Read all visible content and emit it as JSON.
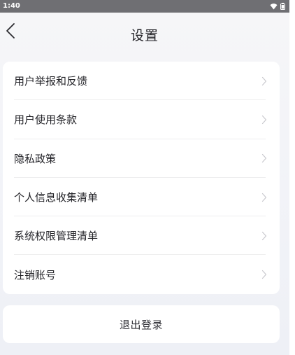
{
  "status_bar": {
    "time": "1:40",
    "icons": [
      "wifi-icon",
      "battery-icon"
    ]
  },
  "header": {
    "back_icon": "chevron-left-icon",
    "title": "设置"
  },
  "menu": {
    "items": [
      {
        "label": "用户举报和反馈",
        "icon": "chevron-right-icon"
      },
      {
        "label": "用户使用条款",
        "icon": "chevron-right-icon"
      },
      {
        "label": "隐私政策",
        "icon": "chevron-right-icon"
      },
      {
        "label": "个人信息收集清单",
        "icon": "chevron-right-icon"
      },
      {
        "label": "系统权限管理清单",
        "icon": "chevron-right-icon"
      },
      {
        "label": "注销账号",
        "icon": "chevron-right-icon"
      }
    ]
  },
  "logout": {
    "label": "退出登录"
  },
  "colors": {
    "status_bar_bg": "#6f6f73",
    "page_bg": "#f3f4f8",
    "card_bg": "#ffffff",
    "text_primary": "#232328",
    "chevron": "#c9c9ce",
    "divider": "#eeeeef"
  }
}
